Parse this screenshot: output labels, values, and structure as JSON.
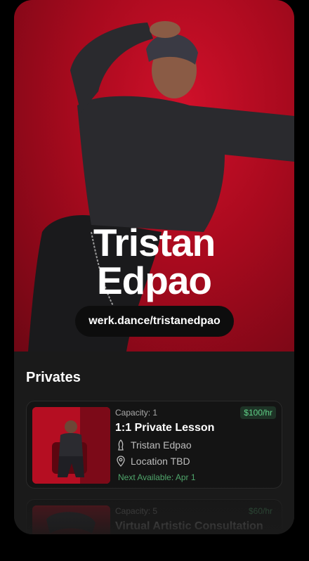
{
  "profile": {
    "name": "Tristan\nEdpao",
    "handle": "werk.dance/tristanedpao"
  },
  "privates": {
    "section_title": "Privates",
    "cards": [
      {
        "capacity": "Capacity: 1",
        "price": "$100/hr",
        "title": "1:1 Private Lesson",
        "instructor": "Tristan Edpao",
        "location": "Location TBD",
        "next_available": "Next Available: Apr 1"
      },
      {
        "capacity": "Capacity: 5",
        "price": "$60/hr",
        "title": "Virtual Artistic Consultation"
      }
    ]
  },
  "colors": {
    "hero_red": "#c00a24",
    "price_green": "#5fcf86",
    "background": "#000000"
  },
  "icons": [
    "person-silhouette-icon",
    "location-pin-icon"
  ]
}
